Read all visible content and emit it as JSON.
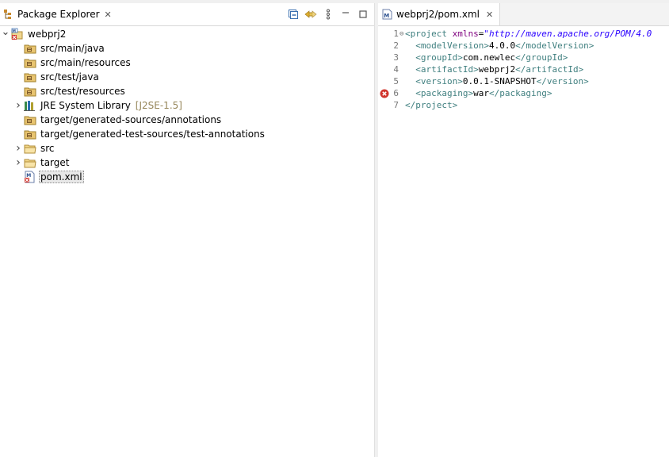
{
  "explorer": {
    "title": "Package Explorer",
    "close_glyph": "✕",
    "tree": [
      {
        "label": "webprj2",
        "icon": "maven-project-icon",
        "arrow": "expanded",
        "indent": 0
      },
      {
        "label": "src/main/java",
        "icon": "source-folder-icon",
        "arrow": "",
        "indent": 1
      },
      {
        "label": "src/main/resources",
        "icon": "source-folder-icon",
        "arrow": "",
        "indent": 1
      },
      {
        "label": "src/test/java",
        "icon": "source-folder-icon",
        "arrow": "",
        "indent": 1
      },
      {
        "label": "src/test/resources",
        "icon": "source-folder-icon",
        "arrow": "",
        "indent": 1
      },
      {
        "label": "JRE System Library",
        "decoration": "[J2SE-1.5]",
        "icon": "library-icon",
        "arrow": "collapsed",
        "indent": 1
      },
      {
        "label": "target/generated-sources/annotations",
        "icon": "source-folder-icon",
        "arrow": "",
        "indent": 1
      },
      {
        "label": "target/generated-test-sources/test-annotations",
        "icon": "source-folder-icon",
        "arrow": "",
        "indent": 1
      },
      {
        "label": "src",
        "icon": "folder-icon",
        "arrow": "collapsed",
        "indent": 1
      },
      {
        "label": "target",
        "icon": "folder-icon",
        "arrow": "collapsed",
        "indent": 1
      },
      {
        "label": "pom.xml",
        "icon": "xml-file-icon",
        "arrow": "",
        "indent": 1,
        "selected": true
      }
    ]
  },
  "editor": {
    "tab_title": "webprj2/pom.xml",
    "close_glyph": "✕",
    "error_line": 6,
    "lines": [
      {
        "n": "1",
        "fold": "⊖",
        "parts": [
          [
            "t",
            "<project "
          ],
          [
            "a",
            "xmlns"
          ],
          [
            "tx",
            "="
          ],
          [
            "v",
            "\"http://maven.apache.org/POM/4.0"
          ]
        ]
      },
      {
        "n": "2",
        "fold": "",
        "parts": [
          [
            "tx",
            "  "
          ],
          [
            "t",
            "<modelVersion>"
          ],
          [
            "tx",
            "4.0.0"
          ],
          [
            "t",
            "</modelVersion>"
          ]
        ]
      },
      {
        "n": "3",
        "fold": "",
        "parts": [
          [
            "tx",
            "  "
          ],
          [
            "t",
            "<groupId>"
          ],
          [
            "tx",
            "com.newlec"
          ],
          [
            "t",
            "</groupId>"
          ]
        ]
      },
      {
        "n": "4",
        "fold": "",
        "parts": [
          [
            "tx",
            "  "
          ],
          [
            "t",
            "<artifactId>"
          ],
          [
            "tx",
            "webprj2"
          ],
          [
            "t",
            "</artifactId>"
          ]
        ]
      },
      {
        "n": "5",
        "fold": "",
        "parts": [
          [
            "tx",
            "  "
          ],
          [
            "t",
            "<version>"
          ],
          [
            "tx",
            "0.0.1-SNAPSHOT"
          ],
          [
            "t",
            "</version>"
          ]
        ]
      },
      {
        "n": "6",
        "fold": "",
        "parts": [
          [
            "tx",
            "  "
          ],
          [
            "t",
            "<packaging>"
          ],
          [
            "tx",
            "war"
          ],
          [
            "t",
            "</packaging>"
          ]
        ]
      },
      {
        "n": "7",
        "fold": "",
        "parts": [
          [
            "t",
            "</project>"
          ]
        ]
      }
    ]
  },
  "colors": {
    "tag": "#3f7f7f",
    "attribute": "#7f007f",
    "attr_value": "#2a00ff",
    "decoration": "#96865a",
    "error": "#d0342c"
  }
}
